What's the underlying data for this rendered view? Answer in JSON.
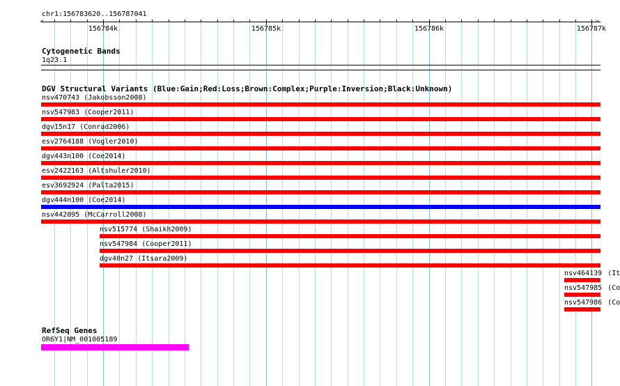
{
  "location": "chr1:156783620..156787041",
  "ruler": {
    "ticks": [
      "156784k",
      "156785k",
      "156786k",
      "156787k"
    ]
  },
  "cytoband": {
    "title": "Cytogenetic Bands",
    "band": "1q23.1"
  },
  "dgv": {
    "title": "DGV Structural Variants (Blue:Gain;Red:Loss;Brown:Complex;Purple:Inversion;Black:Unknown)",
    "items": [
      {
        "id": "nsv470743",
        "study": "(Jakobsson2008)",
        "color": "#ff0000"
      },
      {
        "id": "nsv547983",
        "study": "(Cooper2011)",
        "color": "#ff0000"
      },
      {
        "id": "dgv15n17",
        "study": "(Conrad2006)",
        "color": "#ff0000"
      },
      {
        "id": "esv2764188",
        "study": "(Vogler2010)",
        "color": "#ff0000"
      },
      {
        "id": "dgv443n100",
        "study": "(Coe2014)",
        "color": "#ff0000"
      },
      {
        "id": "esv2422163",
        "study": "(Altshuler2010)",
        "color": "#ff0000"
      },
      {
        "id": "esv3692924",
        "study": "(Palta2015)",
        "color": "#ff0000"
      },
      {
        "id": "dgv444n100",
        "study": "(Coe2014)",
        "color": "#0000ff"
      },
      {
        "id": "nsv442095",
        "study": "(McCarroll2008)",
        "color": "#ff0000"
      },
      {
        "id": "nsv515774",
        "study": "(Shaikh2009)",
        "color": "#ff0000"
      },
      {
        "id": "nsv547984",
        "study": "(Cooper2011)",
        "color": "#ff0000"
      },
      {
        "id": "dgv40n27",
        "study": "(Itsara2009)",
        "color": "#ff0000"
      },
      {
        "id": "nsv464139",
        "study": "(Its",
        "color": "#ff0000"
      },
      {
        "id": "nsv547985",
        "study": "(Coo",
        "color": "#ff0000"
      },
      {
        "id": "nsv547986",
        "study": "(Coo",
        "color": "#ff0000"
      }
    ]
  },
  "refseq": {
    "title": "RefSeq Genes",
    "gene": "OR6Y1|NM_001005189",
    "color": "#ff00ff"
  }
}
